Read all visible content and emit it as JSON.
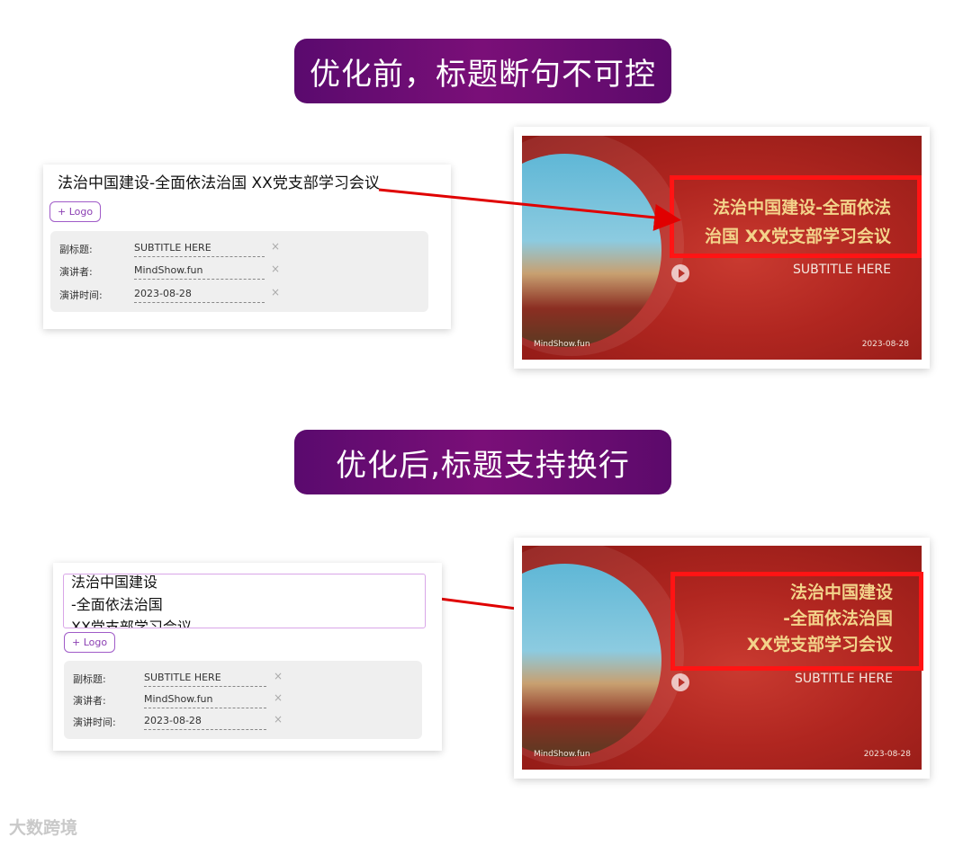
{
  "top": {
    "banner": "优化前，标题断句不可控",
    "form": {
      "title": "法治中国建设-全面依法治国 XX党支部学习会议",
      "logo_button": "+ Logo",
      "fields": [
        {
          "label": "副标题:",
          "value": "SUBTITLE HERE"
        },
        {
          "label": "演讲者:",
          "value": "MindShow.fun"
        },
        {
          "label": "演讲时间:",
          "value": "2023-08-28"
        }
      ],
      "remove": "×"
    },
    "slide": {
      "title_lines": [
        "法治中国建设-全面依法",
        "治国 XX党支部学习会议"
      ],
      "subtitle": "SUBTITLE HERE",
      "footer_left": "MindShow.fun",
      "footer_right": "2023-08-28"
    }
  },
  "bottom": {
    "banner": "优化后,标题支持换行",
    "form": {
      "title_lines": [
        "法治中国建设",
        "-全面依法治国",
        "XX党支部学习会议"
      ],
      "logo_button": "+ Logo",
      "fields": [
        {
          "label": "副标题:",
          "value": "SUBTITLE HERE"
        },
        {
          "label": "演讲者:",
          "value": "MindShow.fun"
        },
        {
          "label": "演讲时间:",
          "value": "2023-08-28"
        }
      ],
      "remove": "×"
    },
    "slide": {
      "title_lines": [
        "法治中国建设",
        "-全面依法治国",
        "XX党支部学习会议"
      ],
      "subtitle": "SUBTITLE HERE",
      "footer_left": "MindShow.fun",
      "footer_right": "2023-08-28"
    }
  },
  "watermark": "大数跨境",
  "colors": {
    "banner": "#6b0d72",
    "highlight": "#ff1414",
    "slide_red": "#b02620",
    "slide_title": "#f3d38a"
  }
}
